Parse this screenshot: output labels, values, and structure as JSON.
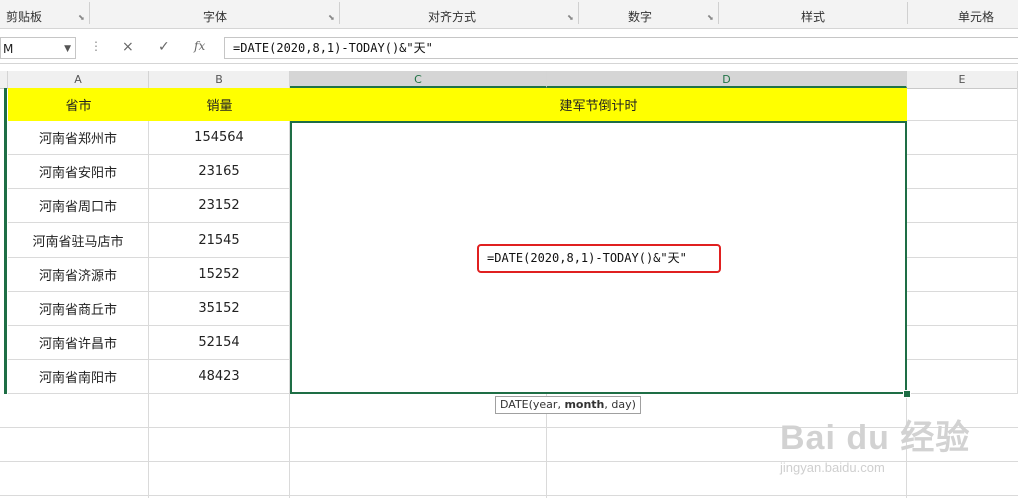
{
  "ribbon": {
    "groups": [
      "剪贴板",
      "字体",
      "对齐方式",
      "数字",
      "样式",
      "单元格"
    ]
  },
  "formula_bar": {
    "name_box": "M",
    "cancel_icon": "×",
    "enter_icon": "✓",
    "fx_label": "fx",
    "formula": "=DATE(2020,8,1)-TODAY()&\"天\""
  },
  "columns": [
    "A",
    "B",
    "C",
    "D",
    "E"
  ],
  "sheet": {
    "header": {
      "province_city": "省市",
      "sales": "销量",
      "countdown": "建军节倒计时"
    },
    "rows": [
      {
        "city": "河南省郑州市",
        "sales": "154564"
      },
      {
        "city": "河南省安阳市",
        "sales": "23165"
      },
      {
        "city": "河南省周口市",
        "sales": "23152"
      },
      {
        "city": "河南省驻马店市",
        "sales": "21545"
      },
      {
        "city": "河南省济源市",
        "sales": "15252"
      },
      {
        "city": "河南省商丘市",
        "sales": "35152"
      },
      {
        "city": "河南省许昌市",
        "sales": "52154"
      },
      {
        "city": "河南省南阳市",
        "sales": "48423"
      }
    ],
    "edit_formula": "=DATE(2020,8,1)-TODAY()&\"天\""
  },
  "tooltip": {
    "prefix": "DATE(year, ",
    "bold": "month",
    "suffix": ", day)"
  },
  "watermark": {
    "logo": "Bai du 经验",
    "url": "jingyan.baidu.com"
  },
  "colors": {
    "header_fill": "#ffff00",
    "selection": "#1e6e45",
    "editor_border": "#e02020"
  }
}
